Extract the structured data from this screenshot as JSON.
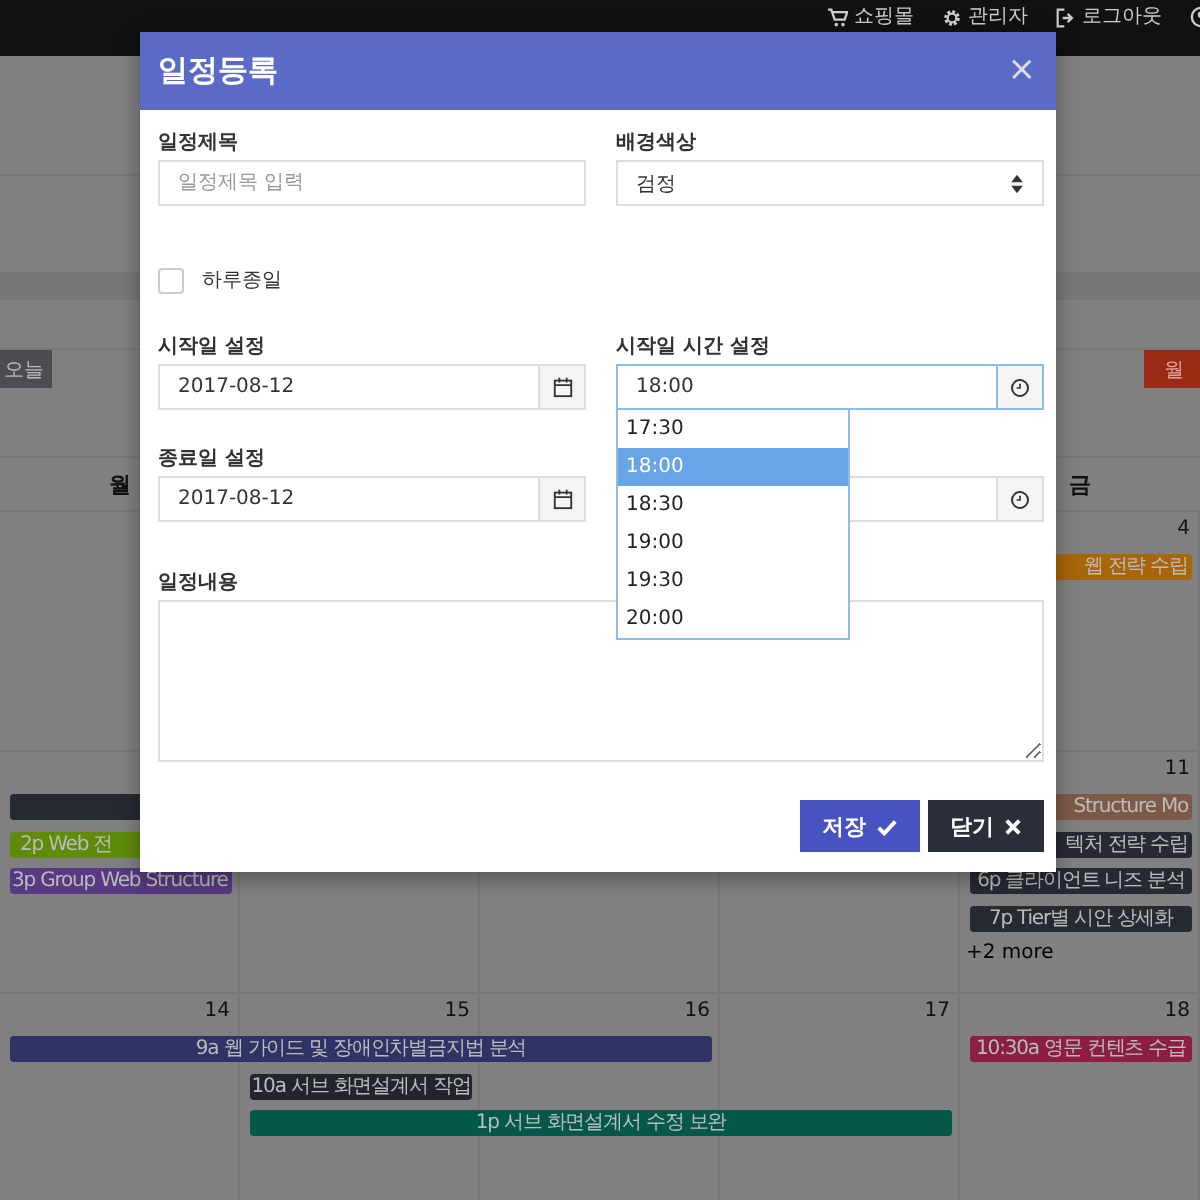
{
  "top_nav": [
    {
      "label": "쇼핑몰"
    },
    {
      "label": "관리자"
    },
    {
      "label": "로그아웃"
    }
  ],
  "calendar": {
    "today_button": "오늘",
    "view_button": "월",
    "weekday_headers": [
      "월",
      "금"
    ],
    "weeks": [
      {
        "dates": [
          "4"
        ],
        "events": [
          {
            "text": "웹 전략 수립",
            "color": "#a8650a",
            "kind": "cut-left"
          }
        ]
      },
      {
        "dates": [
          "11"
        ],
        "events": [
          {
            "color": "#262a33",
            "kind": "cut-right"
          },
          {
            "text": "2p Web 전",
            "color": "#5f8a0a",
            "kind": "cut-right"
          },
          {
            "text": "3p Group Web Structure",
            "color": "#573a82",
            "kind": "cut-end"
          },
          {
            "text": "Structure Mo",
            "color": "#7d5a47",
            "kind": "cut-left"
          },
          {
            "text": "텍처 전략 수립",
            "color": "#262a33",
            "kind": "cut-left"
          },
          {
            "text": "6p 클라이언트 니즈 분석",
            "color": "#262a33",
            "kind": "full"
          },
          {
            "text": "7p Tier별 시안 상세화",
            "color": "#262a33",
            "kind": "full"
          }
        ],
        "more_link": "+2 more"
      },
      {
        "dates": [
          "14",
          "15",
          "16",
          "17",
          "18"
        ],
        "events": [
          {
            "text": "9a 웹 가이드 및 장애인차별금지법 분석",
            "color": "#2e3566",
            "kind": "full"
          },
          {
            "text": "10:30a 영문 컨텐츠 수급",
            "color": "#8c1d44",
            "kind": "full"
          },
          {
            "text": "10a 서브 화면설계서 작업",
            "color": "#22252d",
            "kind": "full"
          },
          {
            "text": "1p 서브 화면설계서 수정 보완",
            "color": "#03584a",
            "kind": "full"
          }
        ]
      }
    ]
  },
  "modal": {
    "title": "일정등록",
    "close": "×",
    "title_field": {
      "label": "일정제목",
      "placeholder": "일정제목 입력"
    },
    "color_field": {
      "label": "배경색상",
      "value": "검정"
    },
    "all_day": {
      "label": "하루종일",
      "checked": false
    },
    "start_date": {
      "label": "시작일 설정",
      "value": "2017-08-12"
    },
    "start_time": {
      "label": "시작일 시간 설정",
      "value": "18:00"
    },
    "time_dropdown": {
      "options": [
        {
          "label": "17:30",
          "selected": false
        },
        {
          "label": "18:00",
          "selected": true
        },
        {
          "label": "18:30",
          "selected": false
        },
        {
          "label": "19:00",
          "selected": false
        },
        {
          "label": "19:30",
          "selected": false
        },
        {
          "label": "20:00",
          "selected": false
        }
      ]
    },
    "end_date": {
      "label": "종료일 설정",
      "value": "2017-08-12"
    },
    "content": {
      "label": "일정내용"
    },
    "buttons": [
      {
        "label": "저장",
        "kind": "primary"
      },
      {
        "label": "닫기",
        "kind": "close"
      }
    ]
  }
}
